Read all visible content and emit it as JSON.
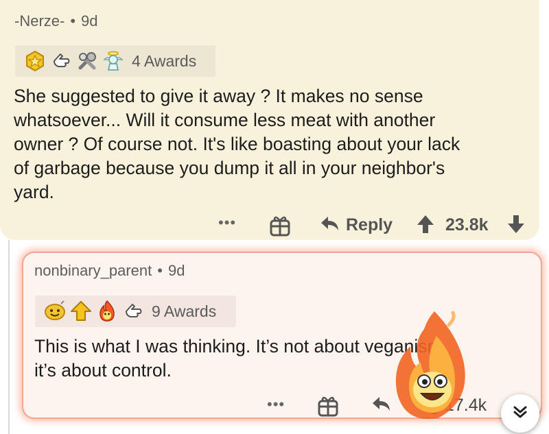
{
  "comments": [
    {
      "author": "-Nerze-",
      "separator": "•",
      "age": "9d",
      "awards": {
        "icons": [
          "gold-crown-award-icon",
          "silver-hand-award-icon",
          "wrench-award-icon",
          "angel-award-icon"
        ],
        "count_label": "4 Awards"
      },
      "body_lines": [
        "She suggested to give it away ? It makes no sense",
        "whatsoever... Will it consume less meat with another",
        "owner ? Of course not. It's like boasting about your lack",
        "of garbage because you dump it all in your neighbor's",
        "yard."
      ],
      "actions": {
        "more": "•••",
        "reply": "Reply",
        "score": "23.8k"
      }
    },
    {
      "author": "nonbinary_parent",
      "separator": "•",
      "age": "9d",
      "awards": {
        "icons": [
          "wholesome-award-icon",
          "gold-upvote-award-icon",
          "fire-award-icon",
          "silver-hand-award-icon"
        ],
        "count_label": "9 Awards"
      },
      "body_lines": [
        "This is what I was thinking. It’s not about veganism,",
        "it’s about control."
      ],
      "actions": {
        "more": "•••",
        "score": "17.4k"
      }
    }
  ],
  "colors": {
    "card1_bg": "#f8f2dc",
    "card2_bg": "#fdf3ef",
    "card2_glow": "#f1a592"
  }
}
